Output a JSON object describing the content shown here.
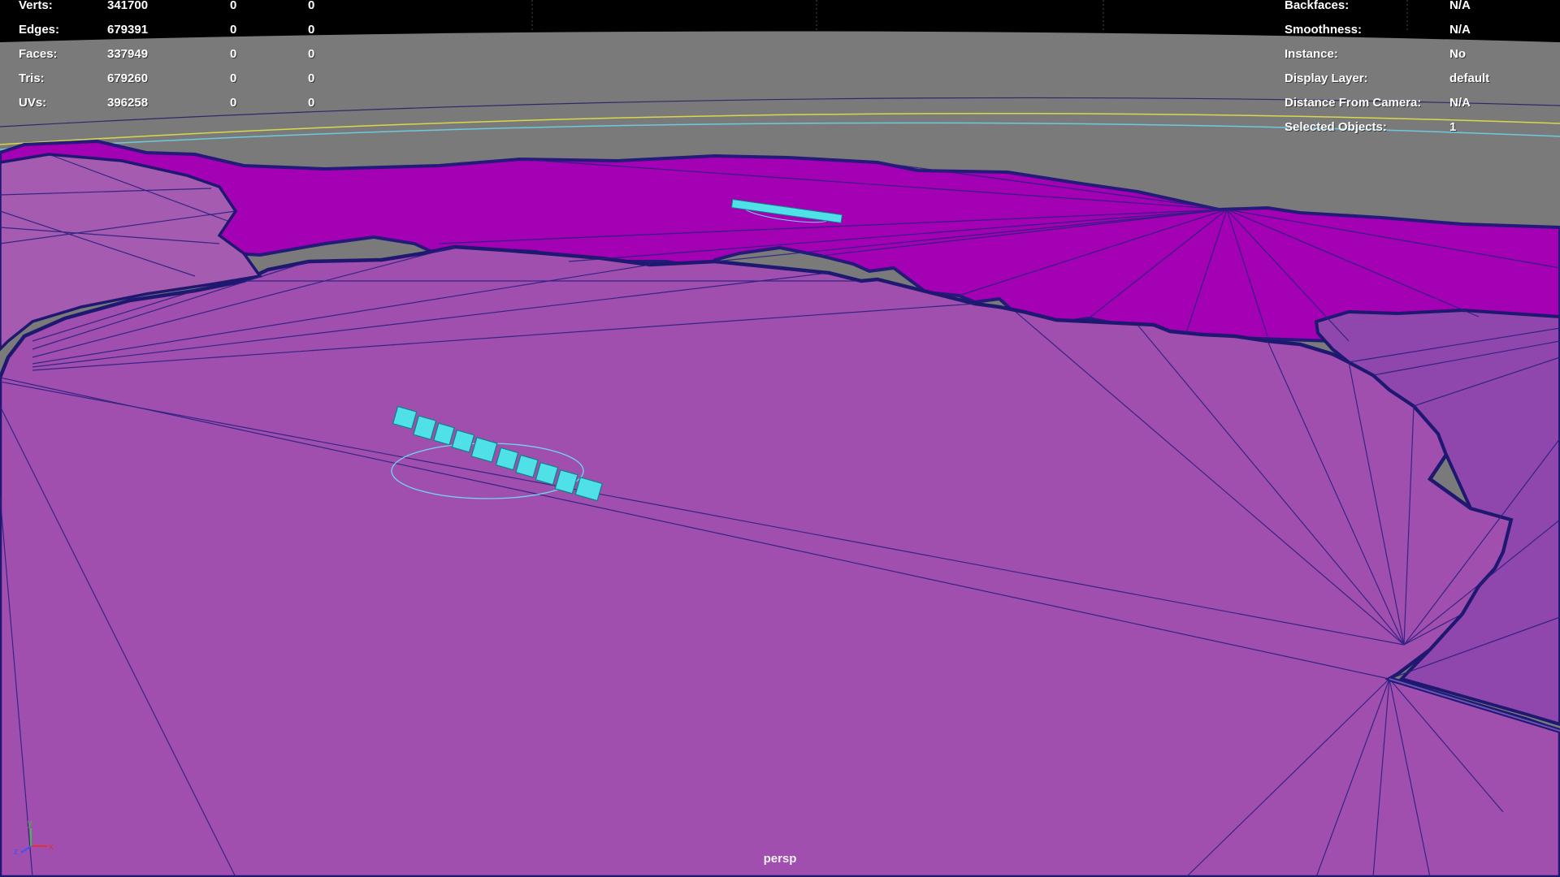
{
  "viewport": {
    "camera": "persp",
    "colors": {
      "top_bar": "#000000",
      "background": "#7a7a7a",
      "ground": "#a04fae",
      "ground_far": "#a400b4",
      "ground_right": "#8f46ad",
      "edge": "#241a7a",
      "edge_thick": "#1f1870",
      "text_object": "#4fe0e8",
      "horizon_yellow": "#d8d84a",
      "horizon_cyan": "#6fc8e0"
    }
  },
  "heads_up_left": {
    "rows": [
      {
        "label": "Verts:",
        "values": [
          "341700",
          "0",
          "0"
        ]
      },
      {
        "label": "Edges:",
        "values": [
          "679391",
          "0",
          "0"
        ]
      },
      {
        "label": "Faces:",
        "values": [
          "337949",
          "0",
          "0"
        ]
      },
      {
        "label": "Tris:",
        "values": [
          "679260",
          "0",
          "0"
        ]
      },
      {
        "label": "UVs:",
        "values": [
          "396258",
          "0",
          "0"
        ]
      }
    ]
  },
  "heads_up_right": {
    "rows": [
      {
        "label": "Backfaces:",
        "value": "N/A"
      },
      {
        "label": "Smoothness:",
        "value": "N/A"
      },
      {
        "label": "Instance:",
        "value": "No"
      },
      {
        "label": "Display Layer:",
        "value": "default"
      },
      {
        "label": "Distance From Camera:",
        "value": "N/A"
      },
      {
        "label": "Selected Objects:",
        "value": "1"
      }
    ]
  },
  "axis_gizmo": {
    "x_label": "x",
    "y_label": "y",
    "z_label": "z",
    "x_color": "#e03030",
    "y_color": "#3ec03e",
    "z_color": "#4050ff"
  }
}
